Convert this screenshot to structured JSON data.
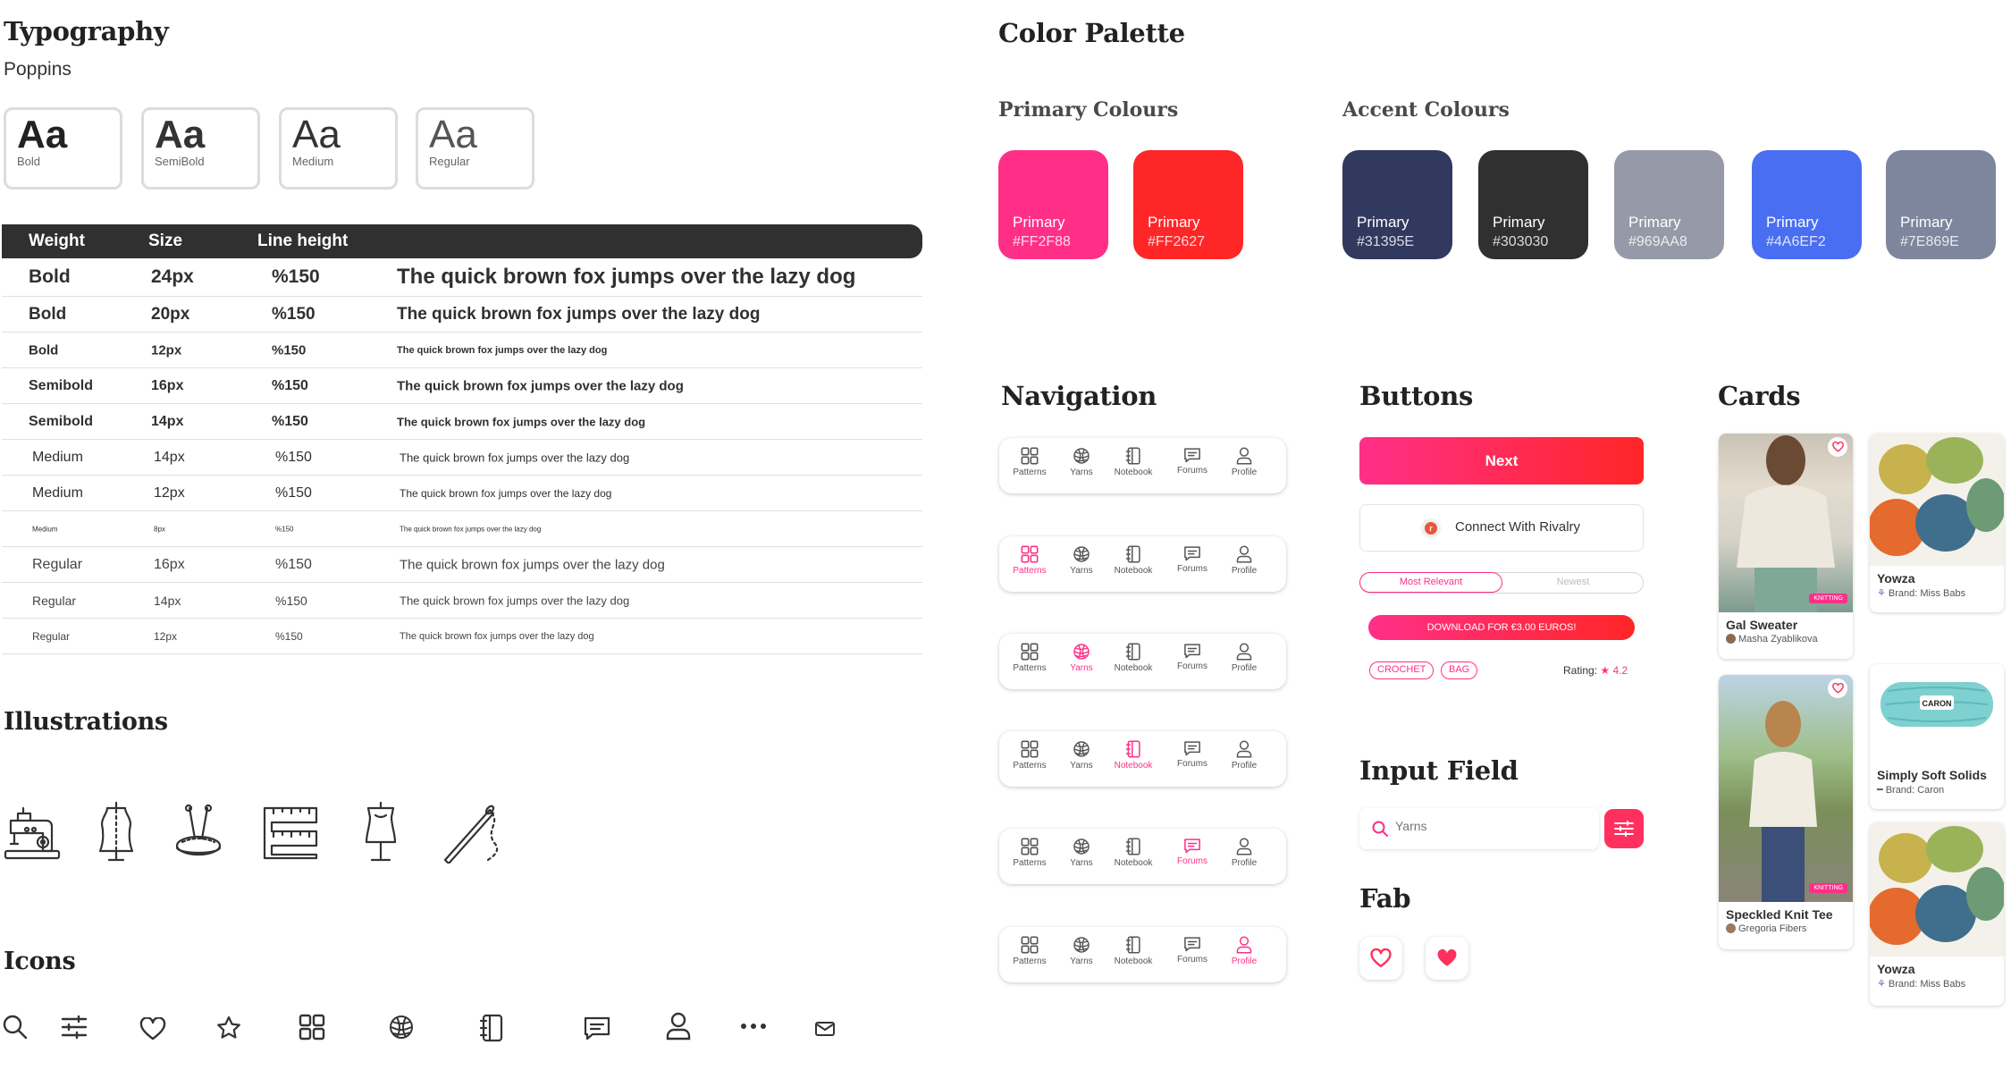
{
  "typography": {
    "title": "Typography",
    "font_name": "Poppins",
    "samples": [
      {
        "glyph": "Aa",
        "label": "Bold"
      },
      {
        "glyph": "Aa",
        "label": "SemiBold"
      },
      {
        "glyph": "Aa",
        "label": "Medium"
      },
      {
        "glyph": "Aa",
        "label": "Regular"
      }
    ],
    "columns": {
      "weight": "Weight",
      "size": "Size",
      "line_height": "Line height"
    },
    "rows": [
      {
        "weight": "Bold",
        "size": "24px",
        "line_height": "%150",
        "sample": "The quick brown fox jumps over the lazy dog"
      },
      {
        "weight": "Bold",
        "size": "20px",
        "line_height": "%150",
        "sample": "The quick brown fox jumps over the lazy dog"
      },
      {
        "weight": "Bold",
        "size": "12px",
        "line_height": "%150",
        "sample": "The quick brown fox jumps over the lazy dog"
      },
      {
        "weight": "Semibold",
        "size": "16px",
        "line_height": "%150",
        "sample": "The quick brown fox jumps over the lazy dog"
      },
      {
        "weight": "Semibold",
        "size": "14px",
        "line_height": "%150",
        "sample": "The quick brown fox jumps over the lazy dog"
      },
      {
        "weight": "Medium",
        "size": "14px",
        "line_height": "%150",
        "sample": "The quick brown fox jumps over the lazy dog"
      },
      {
        "weight": "Medium",
        "size": "12px",
        "line_height": "%150",
        "sample": "The quick brown fox jumps over the lazy dog"
      },
      {
        "weight": "Medium",
        "size": "8px",
        "line_height": "%150",
        "sample": "The quick brown fox jumps over the lazy dog"
      },
      {
        "weight": "Regular",
        "size": "16px",
        "line_height": "%150",
        "sample": "The quick brown fox jumps over the lazy dog"
      },
      {
        "weight": "Regular",
        "size": "14px",
        "line_height": "%150",
        "sample": "The quick brown fox jumps over the lazy dog"
      },
      {
        "weight": "Regular",
        "size": "12px",
        "line_height": "%150",
        "sample": "The quick brown fox jumps over the lazy dog"
      }
    ]
  },
  "illustrations": {
    "title": "Illustrations",
    "items": [
      "sewing-machine-illustration",
      "dress-form-illustration",
      "pincushion-illustration",
      "measuring-tape-illustration",
      "mannequin-illustration",
      "needle-thread-illustration"
    ]
  },
  "icons": {
    "title": "Icons",
    "items": [
      "search-icon",
      "sliders-icon",
      "heart-icon",
      "star-icon",
      "grid-icon",
      "yarn-icon",
      "notebook-icon",
      "chat-icon",
      "user-icon",
      "more-icon",
      "mail-icon"
    ]
  },
  "palette": {
    "title": "Color Palette",
    "primary_title": "Primary Colours",
    "accent_title": "Accent Colours",
    "primary": [
      {
        "name": "Primary",
        "hex": "#FF2F88",
        "color": "#FF2F88"
      },
      {
        "name": "Primary",
        "hex": "#FF2627",
        "color": "#FF2627"
      }
    ],
    "accent": [
      {
        "name": "Primary",
        "hex": "#31395E",
        "color": "#31395E"
      },
      {
        "name": "Primary",
        "hex": "#303030",
        "color": "#303030"
      },
      {
        "name": "Primary",
        "hex": "#969AA8",
        "color": "#969AA8"
      },
      {
        "name": "Primary",
        "hex": "#4A6EF2",
        "color": "#4A6EF2"
      },
      {
        "name": "Primary",
        "hex": "#7E869E",
        "color": "#7E869E"
      }
    ]
  },
  "navigation": {
    "title": "Navigation",
    "tabs": [
      "Patterns",
      "Yarns",
      "Notebook",
      "Forums",
      "Profile"
    ],
    "accent": "#FF2F88"
  },
  "buttons": {
    "title": "Buttons",
    "next_label": "Next",
    "connect_label": "Connect With Rivalry",
    "connect_logo": "r",
    "segment": [
      "Most Relevant",
      "Newest"
    ],
    "download_label": "DOWNLOAD FOR €3.00 EUROS!",
    "chips": [
      "CROCHET",
      "BAG"
    ],
    "rating_label": "Rating:",
    "rating_star": "★",
    "rating_value": "4.2"
  },
  "input_field": {
    "title": "Input Field",
    "placeholder": "Yarns"
  },
  "fab": {
    "title": "Fab"
  },
  "cards": {
    "title": "Cards",
    "items": [
      {
        "title": "Gal Sweater",
        "sub": "Masha Zyablikova",
        "badge": "KNITTING"
      },
      {
        "title": "Speckled Knit Tee",
        "sub": "Gregoria Fibers",
        "badge": "KNITTING"
      },
      {
        "title": "Yowza",
        "sub": "Brand: Miss Babs"
      },
      {
        "title": "Simply Soft Solids",
        "sub": "Brand: Caron",
        "label": "CARON"
      },
      {
        "title": "Yowza",
        "sub": "Brand: Miss Babs"
      }
    ]
  }
}
